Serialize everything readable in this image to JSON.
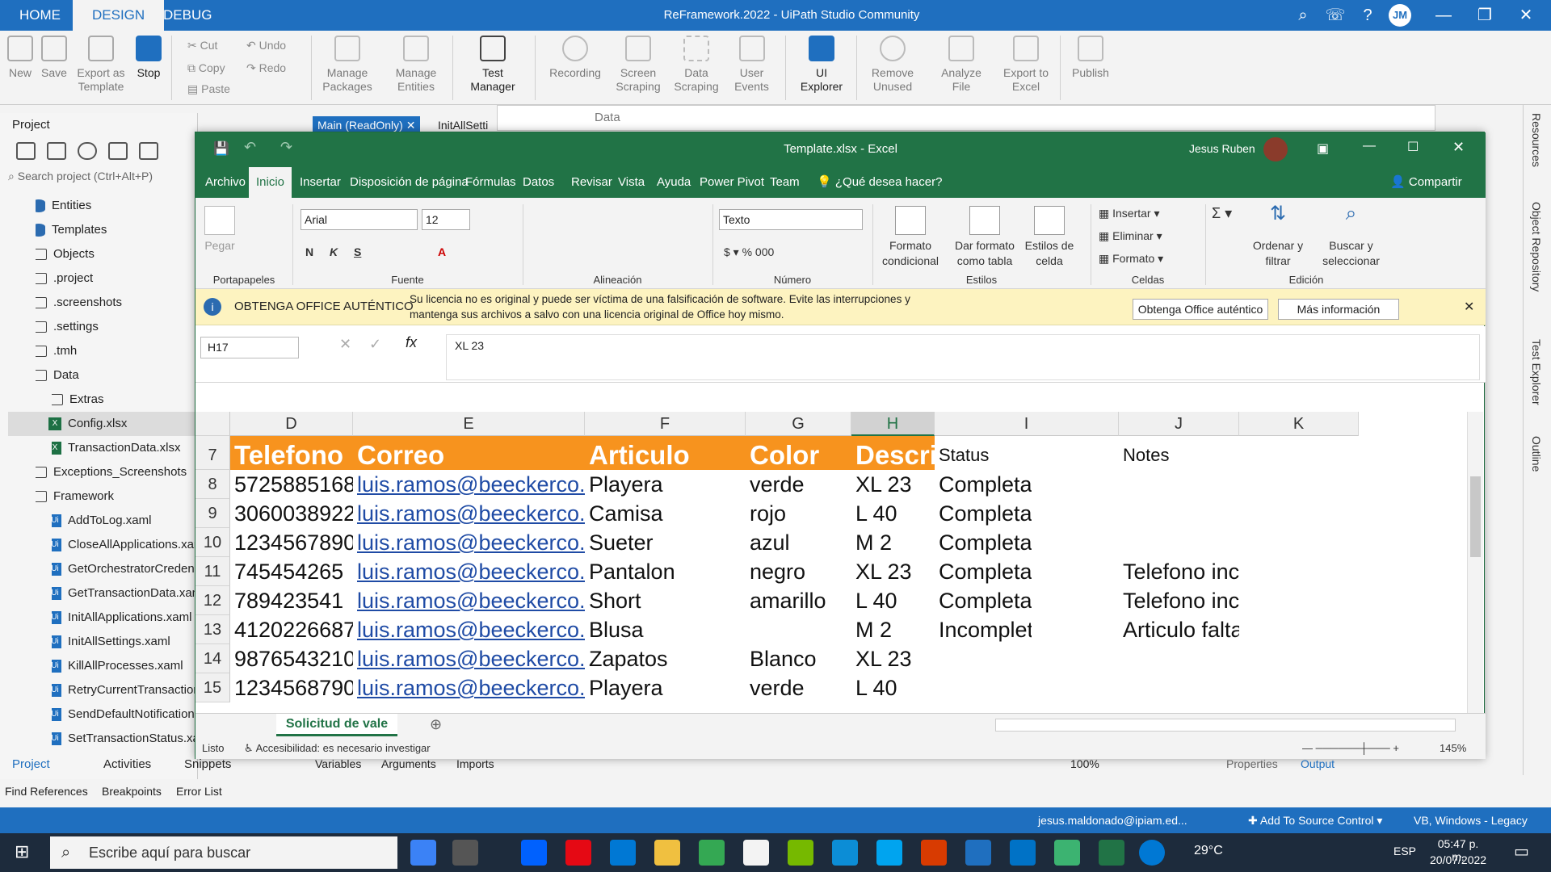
{
  "uipath": {
    "tabs": [
      "HOME",
      "DESIGN",
      "DEBUG"
    ],
    "title": "ReFramework.2022 - UiPath Studio Community",
    "avatar": "JM",
    "ribbon": {
      "new": "New",
      "save": "Save",
      "export_template": "Export as Template",
      "stop": "Stop",
      "cut": "Cut",
      "copy": "Copy",
      "paste": "Paste",
      "undo": "Undo",
      "redo": "Redo",
      "manage_packages": "Manage Packages",
      "manage_entities": "Manage Entities",
      "test_manager": "Test Manager",
      "recording": "Recording",
      "screen_scraping": "Screen Scraping",
      "data_scraping": "Data Scraping",
      "user_events": "User Events",
      "ui_explorer": "UI Explorer",
      "remove_unused": "Remove Unused",
      "analyze_file": "Analyze File",
      "export_excel": "Export to Excel",
      "publish": "Publish"
    },
    "project_panel": {
      "title": "Project",
      "search_placeholder": "Search project (Ctrl+Alt+P)"
    },
    "doc_tabs": [
      "Main (ReadOnly)",
      "InitAllSetti"
    ],
    "tree": [
      {
        "label": "Entities",
        "icon": "entities",
        "level": 1,
        "chev": ""
      },
      {
        "label": "Templates",
        "icon": "templates",
        "level": 1,
        "chev": ""
      },
      {
        "label": "Objects",
        "icon": "folder",
        "level": 1,
        "chev": ">"
      },
      {
        "label": ".project",
        "icon": "folder",
        "level": 1,
        "chev": ">"
      },
      {
        "label": ".screenshots",
        "icon": "folder",
        "level": 1,
        "chev": ">"
      },
      {
        "label": ".settings",
        "icon": "folder",
        "level": 1,
        "chev": ">"
      },
      {
        "label": ".tmh",
        "icon": "folder",
        "level": 1,
        "chev": ">"
      },
      {
        "label": "Data",
        "icon": "folder",
        "level": 1,
        "chev": "v"
      },
      {
        "label": "Extras",
        "icon": "folder",
        "level": 2,
        "chev": ">"
      },
      {
        "label": "Config.xlsx",
        "icon": "excel",
        "level": 2,
        "chev": ""
      },
      {
        "label": "TransactionData.xlsx",
        "icon": "excel",
        "level": 2,
        "chev": ""
      },
      {
        "label": "Exceptions_Screenshots",
        "icon": "folder",
        "level": 1,
        "chev": ">"
      },
      {
        "label": "Framework",
        "icon": "folder",
        "level": 1,
        "chev": "v"
      },
      {
        "label": "AddToLog.xaml",
        "icon": "xaml",
        "level": 2,
        "chev": ""
      },
      {
        "label": "CloseAllApplications.xaml",
        "icon": "xaml",
        "level": 2,
        "chev": ""
      },
      {
        "label": "GetOrchestratorCredential.xaml",
        "icon": "xaml",
        "level": 2,
        "chev": ""
      },
      {
        "label": "GetTransactionData.xaml",
        "icon": "xaml",
        "level": 2,
        "chev": ""
      },
      {
        "label": "InitAllApplications.xaml",
        "icon": "xaml",
        "level": 2,
        "chev": ""
      },
      {
        "label": "InitAllSettings.xaml",
        "icon": "xaml",
        "level": 2,
        "chev": ""
      },
      {
        "label": "KillAllProcesses.xaml",
        "icon": "xaml",
        "level": 2,
        "chev": ""
      },
      {
        "label": "RetryCurrentTransaction.xaml",
        "icon": "xaml",
        "level": 2,
        "chev": ""
      },
      {
        "label": "SendDefaultNotification.xaml",
        "icon": "xaml",
        "level": 2,
        "chev": ""
      },
      {
        "label": "SetTransactionStatus.xaml",
        "icon": "xaml",
        "level": 2,
        "chev": ""
      }
    ],
    "bottom_tabs": [
      "Project",
      "Activities",
      "Snippets"
    ],
    "designer_tabs": [
      "Variables",
      "Arguments",
      "Imports"
    ],
    "zoom": "100%",
    "right_bottom_tabs": [
      "Properties",
      "Output"
    ],
    "find_tabs": [
      "Find References",
      "Breakpoints",
      "Error List"
    ],
    "status": {
      "user": "jesus.maldonado@ipiam.ed...",
      "source_control": "Add To Source Control",
      "runtime": "VB, Windows - Legacy"
    },
    "right_vertical": [
      "Resources",
      "Object Repository",
      "Test Explorer",
      "Outline"
    ],
    "data_window": "Data"
  },
  "excel": {
    "title": "Template.xlsx  -  Excel",
    "user": "Jesus Ruben",
    "menu": [
      "Archivo",
      "Inicio",
      "Insertar",
      "Disposición de página",
      "Fórmulas",
      "Datos",
      "Revisar",
      "Vista",
      "Ayuda",
      "Power Pivot",
      "Team"
    ],
    "tell_me": "¿Qué desea hacer?",
    "share": "Compartir",
    "ribbon": {
      "paste": "Pegar",
      "font": "Arial",
      "size": "12",
      "number_format": "Texto",
      "bold": "N",
      "italic": "K",
      "underline": "S",
      "groups": [
        "Portapapeles",
        "Fuente",
        "Alineación",
        "Número",
        "Estilos",
        "Celdas",
        "Edición"
      ],
      "conditional": "Formato condicional",
      "as_table": "Dar formato como tabla",
      "cell_styles": "Estilos de celda",
      "insert": "Insertar",
      "delete": "Eliminar",
      "format": "Formato",
      "sort": "Ordenar y filtrar",
      "find": "Buscar y seleccionar"
    },
    "notice": {
      "title": "OBTENGA OFFICE AUTÉNTICO",
      "text": "Su licencia no es original y puede ser víctima de una falsificación de software. Evite las interrupciones y mantenga sus archivos a salvo con una licencia original de Office hoy mismo.",
      "btn1": "Obtenga Office auténtico",
      "btn2": "Más información"
    },
    "namebox": "H17",
    "formula": "XL 23",
    "columns": [
      "D",
      "E",
      "F",
      "G",
      "H",
      "I",
      "J",
      "K"
    ],
    "header_row": {
      "row": "7",
      "cells": [
        "Telefono",
        "Correo",
        "Articulo",
        "Color",
        "Descripción",
        "Status",
        "Notes",
        ""
      ]
    },
    "rows": [
      {
        "row": "8",
        "cells": [
          "5725885168",
          "luis.ramos@beeckerco.com",
          "Playera",
          "verde",
          "XL 23",
          "Completado",
          "",
          ""
        ]
      },
      {
        "row": "9",
        "cells": [
          "3060038922",
          "luis.ramos@beeckerco.com",
          "Camisa",
          "rojo",
          "L 40",
          "Completado",
          "",
          ""
        ]
      },
      {
        "row": "10",
        "cells": [
          "1234567890",
          "luis.ramos@beeckerco.com",
          "Sueter",
          "azul",
          "M 2",
          "Completado",
          "",
          ""
        ]
      },
      {
        "row": "11",
        "cells": [
          "745454265",
          "luis.ramos@beeckerco.com",
          "Pantalon",
          "negro",
          "XL 23",
          "Completad",
          "Telefono incorrecto",
          ""
        ]
      },
      {
        "row": "12",
        "cells": [
          "789423541",
          "luis.ramos@beeckerco.com",
          "Short",
          "amarillo",
          "L 40",
          "Completad",
          "Telefono incorrecto",
          ""
        ]
      },
      {
        "row": "13",
        "cells": [
          "4120226687",
          "luis.ramos@beeckerco.com",
          "Blusa",
          "",
          "M 2",
          "Incompleto",
          "Articulo faltante",
          ""
        ]
      },
      {
        "row": "14",
        "cells": [
          "9876543210",
          "luis.ramos@beeckerco.com",
          "Zapatos",
          "Blanco",
          "XL 23",
          "",
          "",
          ""
        ]
      },
      {
        "row": "15",
        "cells": [
          "1234568790",
          "luis.ramos@beeckerco.com",
          "Playera",
          "verde",
          "L 40",
          "",
          "",
          ""
        ]
      }
    ],
    "sheet": "Solicitud de vale",
    "status_ready": "Listo",
    "accessibility": "Accesibilidad: es necesario investigar",
    "zoom": "145%"
  },
  "taskbar": {
    "search": "Escribe aquí para buscar",
    "temp": "29°C",
    "lang": "ESP",
    "time": "05:47 p. m.",
    "date": "20/07/2022"
  }
}
